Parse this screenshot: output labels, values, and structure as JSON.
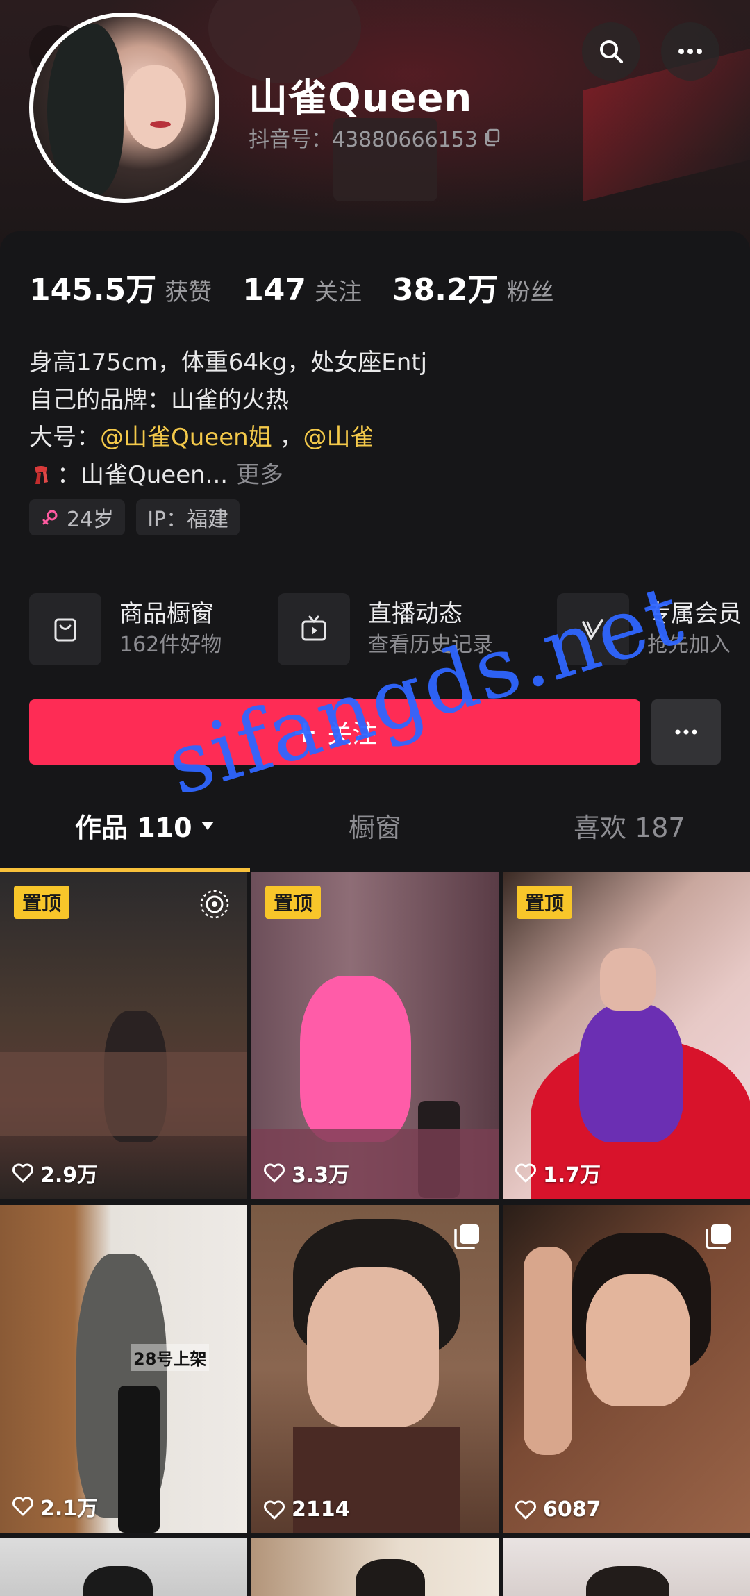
{
  "profile": {
    "nickname": "山雀Queen",
    "douyin_id": "抖音号：43880666153"
  },
  "stats": [
    {
      "value": "145.5万",
      "label": "获赞"
    },
    {
      "value": "147",
      "label": "关注"
    },
    {
      "value": "38.2万",
      "label": "粉丝"
    }
  ],
  "bio": {
    "line1": "身高175cm，体重64kg，处女座Entj",
    "line2": "自己的品牌：山雀的火热",
    "line3_prefix": "大号：",
    "line3_at1": "@山雀Queen姐",
    "line3_sep": " ，",
    "line3_at2": "@山雀",
    "line4_text": "：山雀Queen...",
    "more": "更多"
  },
  "tags": {
    "age": "24岁",
    "ip": "IP：福建"
  },
  "services": [
    {
      "title": "商品橱窗",
      "subtitle": "162件好物",
      "icon": "bag-icon"
    },
    {
      "title": "直播动态",
      "subtitle": "查看历史记录",
      "icon": "tv-icon"
    },
    {
      "title": "专属会员",
      "subtitle": "抢先加入",
      "icon": "v-icon"
    }
  ],
  "actions": {
    "follow": "关注"
  },
  "tabs": [
    {
      "label": "作品 110",
      "active": true
    },
    {
      "label": "橱窗",
      "active": false
    },
    {
      "label": "喜欢 187",
      "active": false
    }
  ],
  "videos": [
    {
      "pinned": "置顶",
      "likes": "2.9万"
    },
    {
      "pinned": "置顶",
      "likes": "3.3万"
    },
    {
      "pinned": "置顶",
      "likes": "1.7万"
    },
    {
      "likes": "2.1万",
      "caption": "28号上架"
    },
    {
      "likes": "2114"
    },
    {
      "likes": "6087"
    }
  ],
  "watermark": "sifangds.net",
  "colors": {
    "accent": "#fe2c55",
    "at_link": "#f4c94a",
    "pin_badge": "#f8c62a",
    "tab_indicator": "#f8c13b",
    "watermark": "#2f66ff"
  }
}
